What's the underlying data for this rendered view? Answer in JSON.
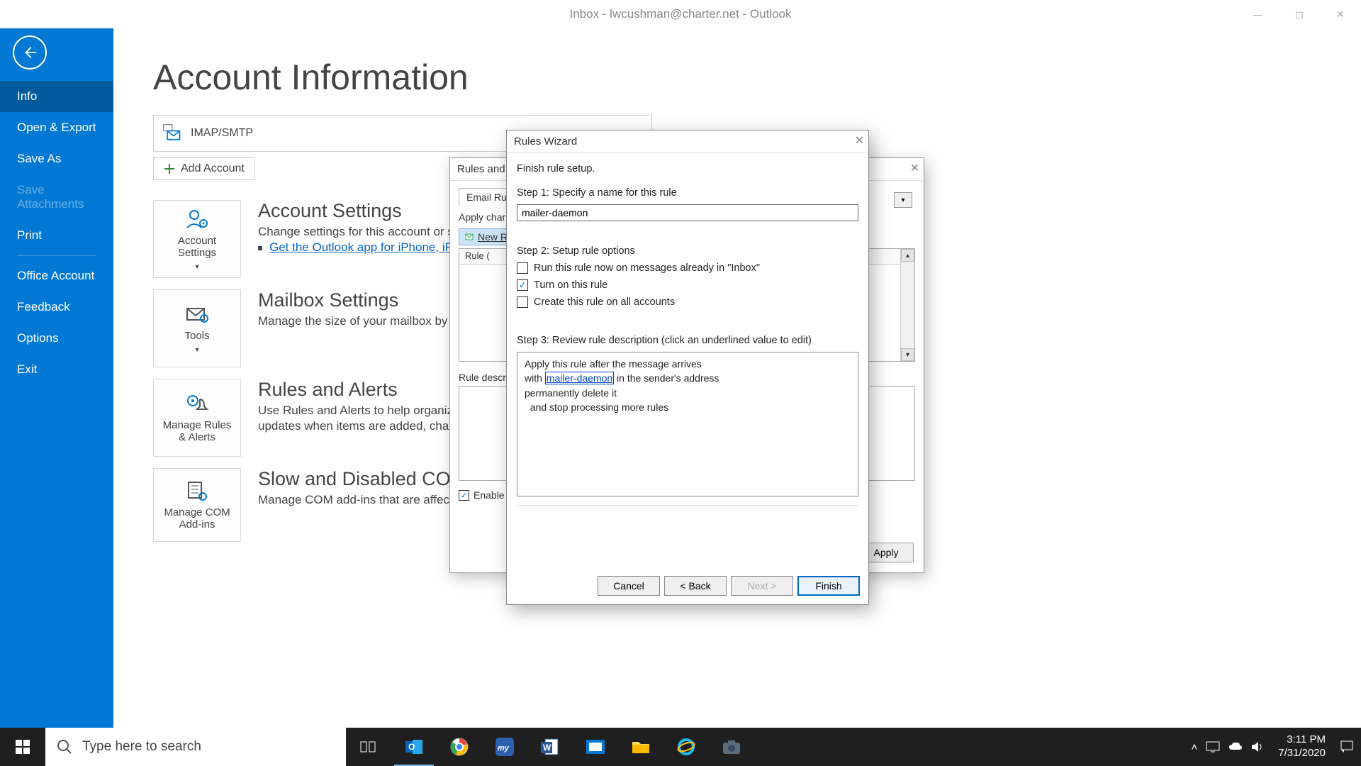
{
  "titlebar": {
    "title": "Inbox - lwcushman@charter.net  -  Outlook"
  },
  "sidebar": {
    "items": [
      {
        "label": "Info",
        "selected": true
      },
      {
        "label": "Open & Export"
      },
      {
        "label": "Save As"
      },
      {
        "label": "Save Attachments",
        "disabled": true
      },
      {
        "label": "Print"
      }
    ],
    "lower": [
      {
        "label": "Office Account"
      },
      {
        "label": "Feedback"
      },
      {
        "label": "Options"
      },
      {
        "label": "Exit"
      }
    ]
  },
  "page": {
    "title": "Account Information",
    "account_type": "IMAP/SMTP",
    "add_account": "Add Account",
    "sections": {
      "settings": {
        "btn": "Account Settings",
        "title": "Account Settings",
        "desc": "Change settings for this account or set up",
        "link": "Get the Outlook app for iPhone, iPad"
      },
      "mailbox": {
        "btn": "Tools",
        "title": "Mailbox Settings",
        "desc": "Manage the size of your mailbox by emp"
      },
      "rules": {
        "btn": "Manage Rules & Alerts",
        "title": "Rules and Alerts",
        "desc": "Use Rules and Alerts to help organize yo",
        "desc2": "updates when items are added, changed"
      },
      "com": {
        "btn": "Manage COM Add-ins",
        "title": "Slow and Disabled COM Ad",
        "desc": "Manage COM add-ins that are affecting"
      }
    }
  },
  "rules_dialog": {
    "title": "Rules and",
    "tab": "Email Rules",
    "apply": "Apply char",
    "new_rule": "New R",
    "col": "Rule (",
    "desc_label": "Rule descr",
    "enable": "Enable",
    "apply_btn": "Apply"
  },
  "wizard": {
    "title": "Rules Wizard",
    "subtitle": "Finish rule setup.",
    "step1": "Step 1: Specify a name for this rule",
    "rule_name": "mailer-daemon",
    "step2": "Step 2: Setup rule options",
    "opt_run_now": "Run this rule now on messages already in \"Inbox\"",
    "opt_turn_on": "Turn on this rule",
    "opt_all_accounts": "Create this rule on all accounts",
    "step3": "Step 3: Review rule description (click an underlined value to edit)",
    "desc": {
      "l1": "Apply this rule after the message arrives",
      "l2a": "with ",
      "l2_link": "mailer-daemon",
      "l2b": " in the sender's address",
      "l3": "permanently delete it",
      "l4": "  and stop processing more rules"
    },
    "buttons": {
      "cancel": "Cancel",
      "back": "< Back",
      "next": "Next >",
      "finish": "Finish"
    }
  },
  "taskbar": {
    "search_placeholder": "Type here to search",
    "time": "3:11 PM",
    "date": "7/31/2020"
  }
}
